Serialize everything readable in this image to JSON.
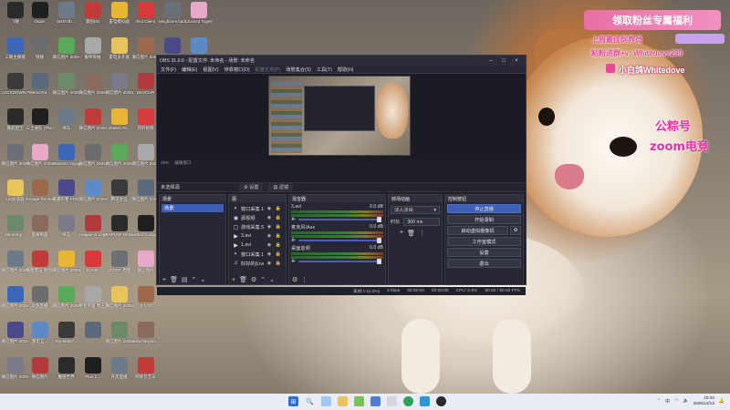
{
  "desktop": {
    "icons": [
      {
        "label": "《敏"
      },
      {
        "label": "Oops!"
      },
      {
        "label": "b0d71fb..."
      },
      {
        "label": "源图DD"
      },
      {
        "label": "雷电模拟器"
      },
      {
        "label": "Riot Client"
      },
      {
        "label": "Neighbors back Fro..."
      },
      {
        "label": "Chained Together"
      },
      {
        "label": "三端主播播"
      },
      {
        "label": "钱锤"
      },
      {
        "label": "微信图片 2025-08..."
      },
      {
        "label": "誓映商推"
      },
      {
        "label": "雷电多开器"
      },
      {
        "label": "微信图片 2025104..."
      },
      {
        "label": ""
      },
      {
        "label": ""
      },
      {
        "label": "LOCKDOWN Protocol"
      },
      {
        "label": "MemoTra..."
      },
      {
        "label": "微信图片 2025107..."
      },
      {
        "label": "微信图片 2025091..."
      },
      {
        "label": "微信图片 2025091..."
      },
      {
        "label": "DEVOUR"
      },
      {
        "label": "嘉航配宝"
      },
      {
        "label": "三士进队 (The King..."
      },
      {
        "label": "书马"
      },
      {
        "label": "微信图片 2025091..."
      },
      {
        "label": "2b69d178..."
      },
      {
        "label": "风铃视频"
      },
      {
        "label": "微信图片 2025070..."
      },
      {
        "label": "微信图片 2025070..."
      },
      {
        "label": "Blossom Voyage"
      },
      {
        "label": "微信图片 2025091..."
      },
      {
        "label": "微信图片 2025091..."
      },
      {
        "label": "微信图片 2025107..."
      },
      {
        "label": "UU加速器"
      },
      {
        "label": "Escape the Backrooms"
      },
      {
        "label": "嘉嘉听看 FGG..."
      },
      {
        "label": "微信图片 2025091..."
      },
      {
        "label": "腾讯会议"
      },
      {
        "label": "微信图片 2025070..."
      },
      {
        "label": "NeonAby..."
      },
      {
        "label": "逃离断崖"
      },
      {
        "label": "书马"
      },
      {
        "label": "League of Legends"
      },
      {
        "label": "RAPVAP Gemio"
      },
      {
        "label": "Lethal Company"
      },
      {
        "label": "微信图片 2025-07..."
      },
      {
        "label": "嘉图需证 地图..."
      },
      {
        "label": "微信图片 2025070..."
      },
      {
        "label": "KOOK"
      },
      {
        "label": "LCGOT 周星"
      },
      {
        "label": "微信图片"
      },
      {
        "label": "微信图片 2025-07..."
      },
      {
        "label": "斗鱼直播"
      },
      {
        "label": "微信图片 2025070..."
      },
      {
        "label": "所有英雄 周五节..."
      },
      {
        "label": "微信图片 2025091..."
      },
      {
        "label": "S.C.G"
      },
      {
        "label": "微信图片 2025-07..."
      },
      {
        "label": "雷电五..."
      },
      {
        "label": "Toy-5b667..."
      },
      {
        "label": "..."
      },
      {
        "label": "微信图片 2025091..."
      },
      {
        "label": "Drive Beyon..."
      },
      {
        "label": "微信图片 2025-10..."
      },
      {
        "label": "微信图片"
      },
      {
        "label": "魔兽世界"
      },
      {
        "label": "Plan 1..."
      },
      {
        "label": "开黑直播"
      },
      {
        "label": "网易云音乐"
      },
      {
        "label": "微信图片 20251..."
      }
    ]
  },
  "obs": {
    "title": "OBS 31.0.0 - 配置文件: 未命名 - 场景: 未命名",
    "menu": [
      "文件(F)",
      "编辑(E)",
      "视图(V)",
      "停靠窗口(D)",
      "配置文件(P)",
      "场景集合(S)",
      "工具(T)",
      "帮助(H)"
    ],
    "preview_status": [
      "19%",
      "编辑窗口"
    ],
    "toolbar": {
      "no_source": "未选择源",
      "properties": "设置",
      "filters": "滤镜"
    },
    "docks": {
      "scenes": {
        "title": "场景",
        "items": [
          "场景"
        ]
      },
      "sources": {
        "title": "源",
        "items": [
          {
            "icon": "◐",
            "name": "窗口采集 11"
          },
          {
            "icon": "◉",
            "name": "源视频"
          },
          {
            "icon": "▢",
            "name": "游戏采集 5"
          },
          {
            "icon": "▶",
            "name": "3.avi"
          },
          {
            "icon": "▶",
            "name": "1.avi"
          },
          {
            "icon": "◐",
            "name": "窗口采集 11"
          },
          {
            "icon": "♫",
            "name": "好好的(Live)"
          }
        ]
      },
      "mixer": {
        "title": "混音器",
        "channels": [
          {
            "name": "3.avi",
            "db": "0.0 dB"
          },
          {
            "name": "麦克风/Aux",
            "db": "0.0 dB"
          },
          {
            "name": "桌面音频",
            "db": "0.0 dB"
          }
        ]
      },
      "transitions": {
        "title": "转场动画",
        "selected": "淡入淡出",
        "duration_label": "时长",
        "duration": "300 ms"
      },
      "controls": {
        "title": "控制按钮",
        "buttons": [
          "停止直播",
          "开始录制",
          "启动虚拟摄像机",
          "工作室模式",
          "设置",
          "退出"
        ]
      }
    },
    "statusbar": [
      "丢帧 0 (0.0%)",
      "0 kbps",
      "00:00:00",
      "00:00:00",
      "CPU: 0.6%",
      "60.00 / 60.00 FPS"
    ]
  },
  "overlay": {
    "banner": "领取粉丝专属福利",
    "line1": "上周最佳饲养员",
    "line2": "粘粉进群+v: Whitedove299",
    "line3": "小白鸽Whitedove",
    "line4": "公粽号",
    "line5": "zoom电竞"
  },
  "taskbar": {
    "time": "10:33",
    "date": "2025/12/13",
    "lang": "中"
  }
}
